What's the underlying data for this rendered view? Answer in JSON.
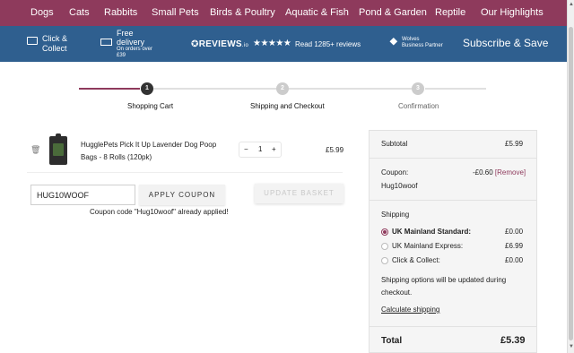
{
  "nav": {
    "items": [
      "Dogs",
      "Cats",
      "Rabbits",
      "Small Pets",
      "Birds & Poultry",
      "Aquatic & Fish",
      "Pond & Garden",
      "Reptile",
      "Our Highlights"
    ]
  },
  "banner": {
    "click_collect_1": "Click &",
    "click_collect_2": "Collect",
    "free_delivery_1": "Free",
    "free_delivery_2": "delivery",
    "free_delivery_3": "On orders over",
    "free_delivery_4": "£39",
    "reviews_brand": "REVIEWS",
    "reviews_suffix": ".io",
    "stars": "★★★★★",
    "read_reviews": "Read 1285+ reviews",
    "wolves_1": "Wolves",
    "wolves_2": "Business Partner",
    "subscribe": "Subscribe & Save"
  },
  "steps": [
    {
      "number": "1",
      "label": "Shopping Cart"
    },
    {
      "number": "2",
      "label": "Shipping and Checkout"
    },
    {
      "number": "3",
      "label": "Confirmation"
    }
  ],
  "cart": {
    "item_name": "HugglePets Pick It Up Lavender Dog Poop Bags - 8 Rolls (120pk)",
    "quantity": "1",
    "minus": "−",
    "plus": "+",
    "price": "£5.99",
    "trash_icon": "🗑"
  },
  "coupon": {
    "input_value": "HUG10WOOF",
    "apply_label": "APPLY COUPON",
    "update_label": "UPDATE BASKET",
    "message": "Coupon code \"Hug10woof\" already applied!"
  },
  "summary": {
    "subtotal_label": "Subtotal",
    "subtotal_value": "£5.99",
    "coupon_label": "Coupon:",
    "coupon_code": "Hug10woof",
    "coupon_value": "-£0.60",
    "remove_label": "[Remove]",
    "shipping_label": "Shipping",
    "shipping_options": [
      {
        "label": "UK Mainland Standard:",
        "price": "£0.00",
        "selected": true
      },
      {
        "label": "UK Mainland Express:",
        "price": "£6.99",
        "selected": false
      },
      {
        "label": "Click & Collect:",
        "price": "£0.00",
        "selected": false
      }
    ],
    "shipping_note_1": "Shipping options will be updated during",
    "shipping_note_2": "checkout.",
    "calc_shipping": "Calculate shipping",
    "total_label": "Total",
    "total_value": "£5.39"
  },
  "colors": {
    "nav_bg": "#8e3a5c",
    "banner_bg": "#2f5f8f",
    "step_active": "#333333",
    "step_inactive": "#c8c8c8",
    "accent": "#8e3a5c"
  }
}
